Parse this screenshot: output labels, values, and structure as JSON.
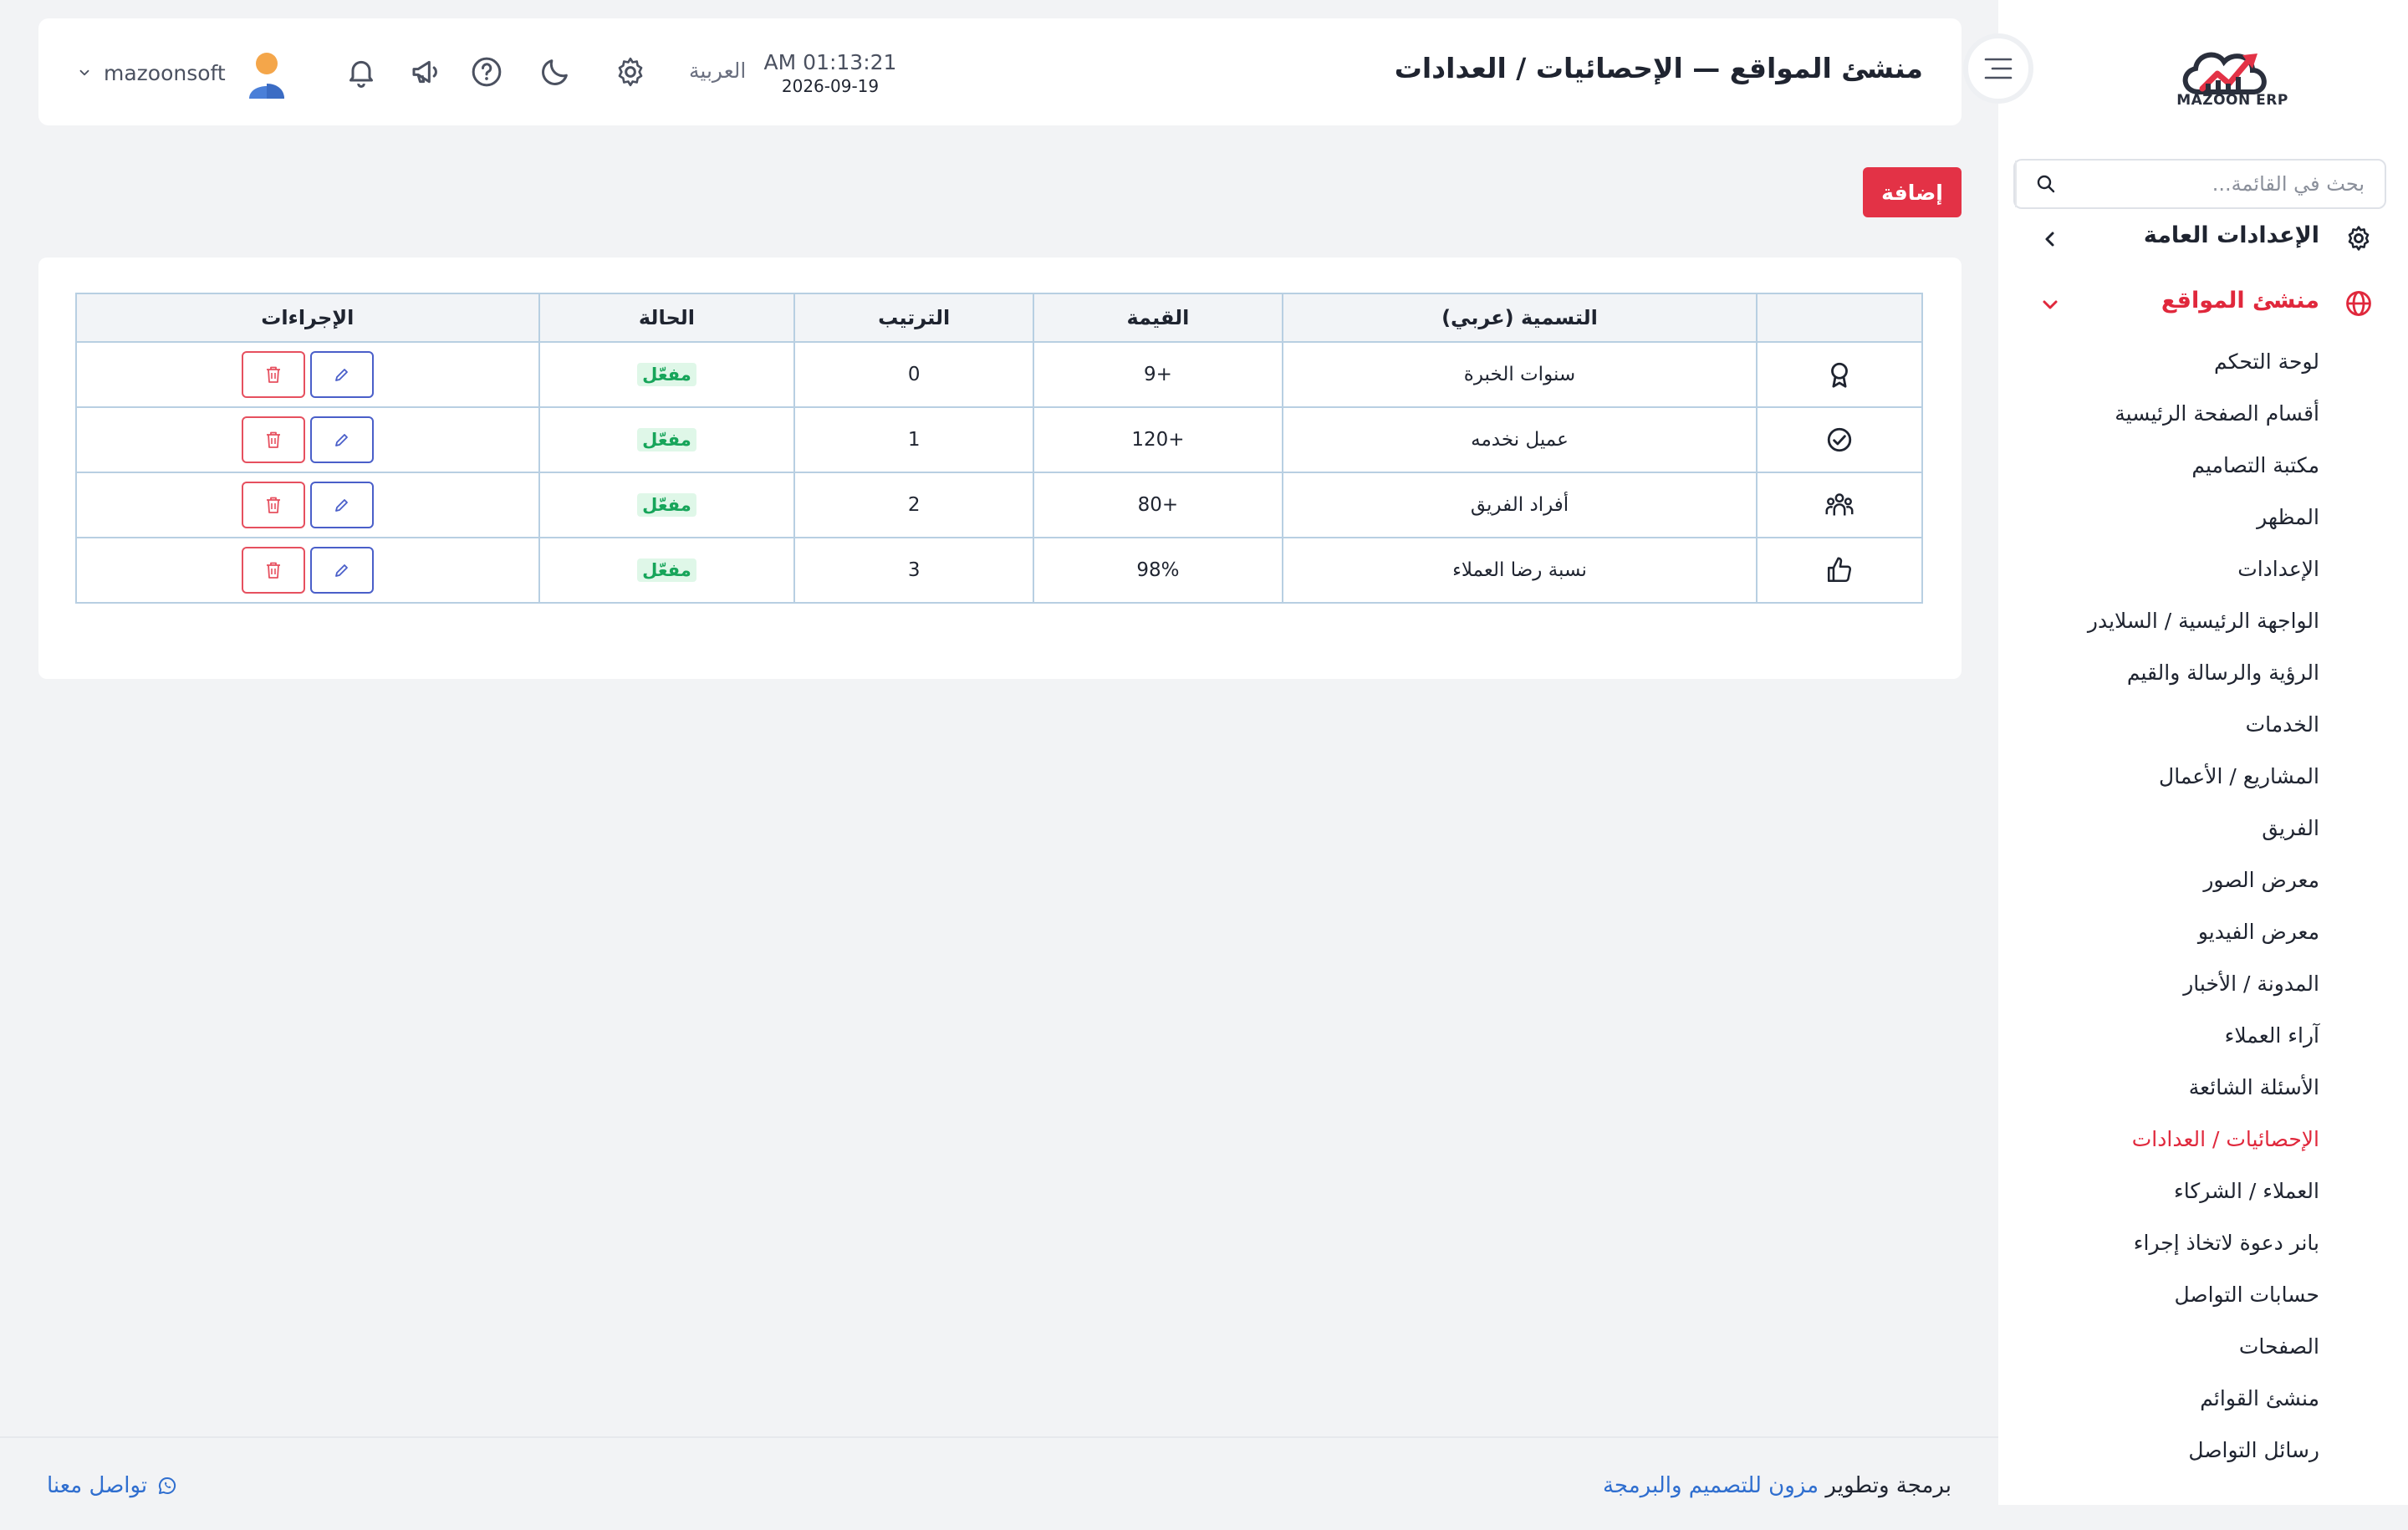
{
  "brand": {
    "name": "MAZOON ERP",
    "colors": {
      "primary": "#e33246",
      "link": "#2f6ecf",
      "success": "#17a55a"
    }
  },
  "sidebar": {
    "search_placeholder": "بحث في القائمة...",
    "groups": [
      {
        "label": "الإعدادات العامة",
        "icon": "gear-icon",
        "expanded": false
      },
      {
        "label": "منشئ المواقع",
        "icon": "globe-icon",
        "expanded": true
      }
    ],
    "items": [
      {
        "label": "لوحة التحكم"
      },
      {
        "label": "أقسام الصفحة الرئيسية"
      },
      {
        "label": "مكتبة التصاميم"
      },
      {
        "label": "المظهر"
      },
      {
        "label": "الإعدادات"
      },
      {
        "label": "الواجهة الرئيسية / السلايدر"
      },
      {
        "label": "الرؤية والرسالة والقيم"
      },
      {
        "label": "الخدمات"
      },
      {
        "label": "المشاريع / الأعمال"
      },
      {
        "label": "الفريق"
      },
      {
        "label": "معرض الصور"
      },
      {
        "label": "معرض الفيديو"
      },
      {
        "label": "المدونة / الأخبار"
      },
      {
        "label": "آراء العملاء"
      },
      {
        "label": "الأسئلة الشائعة"
      },
      {
        "label": "الإحصائيات / العدادات",
        "active": true
      },
      {
        "label": "العملاء / الشركاء"
      },
      {
        "label": "بانر دعوة لاتخاذ إجراء"
      },
      {
        "label": "حسابات التواصل"
      },
      {
        "label": "الصفحات"
      },
      {
        "label": "منشئ القوائم"
      },
      {
        "label": "رسائل التواصل"
      }
    ]
  },
  "header": {
    "title": "منشئ المواقع — الإحصائيات / العدادات",
    "time": "AM 01:13:21",
    "date": "2026-09-19",
    "language": "العربية",
    "username": "mazoonsoft",
    "icons": [
      "gear-icon",
      "moon-icon",
      "help-icon",
      "megaphone-icon",
      "bell-icon"
    ]
  },
  "toolbar": {
    "add_label": "إضافة"
  },
  "table": {
    "headers": {
      "icon": "",
      "name": "التسمية (عربي)",
      "value": "القيمة",
      "order": "الترتيب",
      "status": "الحالة",
      "actions": "الإجراءات"
    },
    "rows": [
      {
        "icon": "award-icon",
        "name": "سنوات الخبرة",
        "value": "+9",
        "order": "0",
        "status": "مفعّل"
      },
      {
        "icon": "check-circle-icon",
        "name": "عميل نخدمه",
        "value": "+120",
        "order": "1",
        "status": "مفعّل"
      },
      {
        "icon": "users-icon",
        "name": "أفراد الفريق",
        "value": "+80",
        "order": "2",
        "status": "مفعّل"
      },
      {
        "icon": "thumbs-up-icon",
        "name": "نسبة رضا العملاء",
        "value": "98%",
        "order": "3",
        "status": "مفعّل"
      }
    ]
  },
  "footer": {
    "credit_prefix": "برمجة وتطوير",
    "credit_link": "مزون للتصميم والبرمجة",
    "contact": "تواصل معنا"
  }
}
